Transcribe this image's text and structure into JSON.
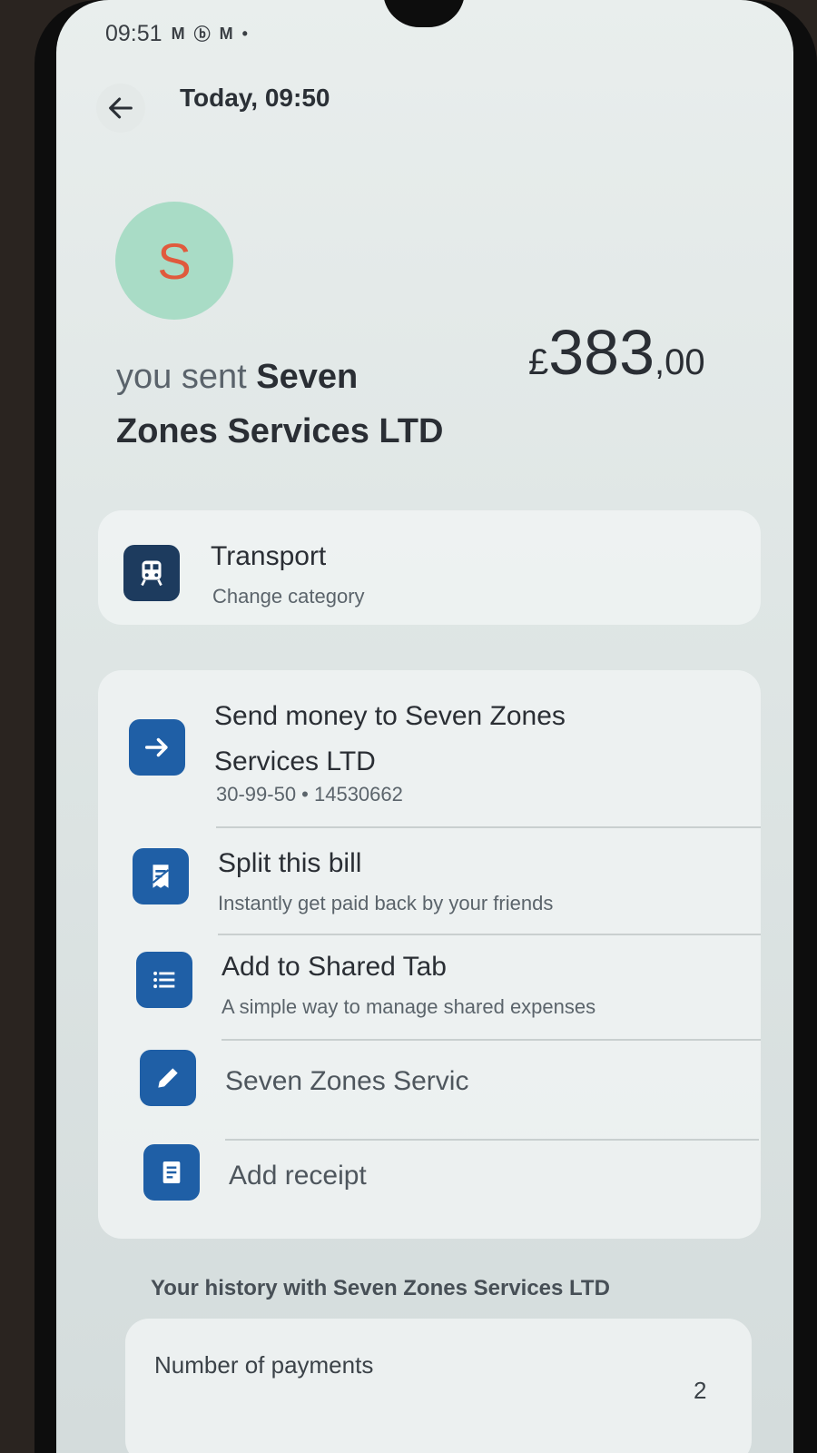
{
  "status_bar": {
    "time": "09:51",
    "icons": [
      "M",
      "ⓑ",
      "M",
      "•"
    ]
  },
  "header": {
    "title": "Today, 09:50"
  },
  "avatar": {
    "initial": "S",
    "bg": "#a9dcc6",
    "fg": "#e05a3d"
  },
  "transaction": {
    "prefix": "you sent ",
    "payee_line1": "Seven",
    "payee_line2": "Zones Services LTD",
    "amount": {
      "currency": "£",
      "whole": "383",
      "fraction": ",00"
    }
  },
  "category": {
    "title": "Transport",
    "subtitle": "Change category",
    "icon": "train-icon"
  },
  "actions": [
    {
      "title_line1": "Send money to Seven Zones",
      "title_line2": "Services LTD",
      "subtitle": "30-99-50 • 14530662",
      "icon": "arrow-right-icon"
    },
    {
      "title": "Split this bill",
      "subtitle": "Instantly get paid back by your friends",
      "icon": "split-bill-icon"
    },
    {
      "title": "Add to Shared Tab",
      "subtitle": "A simple way to manage shared expenses",
      "icon": "list-icon"
    },
    {
      "value": "Seven Zones Servic",
      "icon": "pencil-icon"
    },
    {
      "title": "Add receipt",
      "icon": "receipt-icon"
    }
  ],
  "history": {
    "title": "Your history with Seven Zones Services LTD",
    "rows": [
      {
        "label": "Number of payments",
        "value": "2"
      }
    ]
  },
  "colors": {
    "accent": "#1f5fa6",
    "category_icon": "#1d3b5e"
  }
}
